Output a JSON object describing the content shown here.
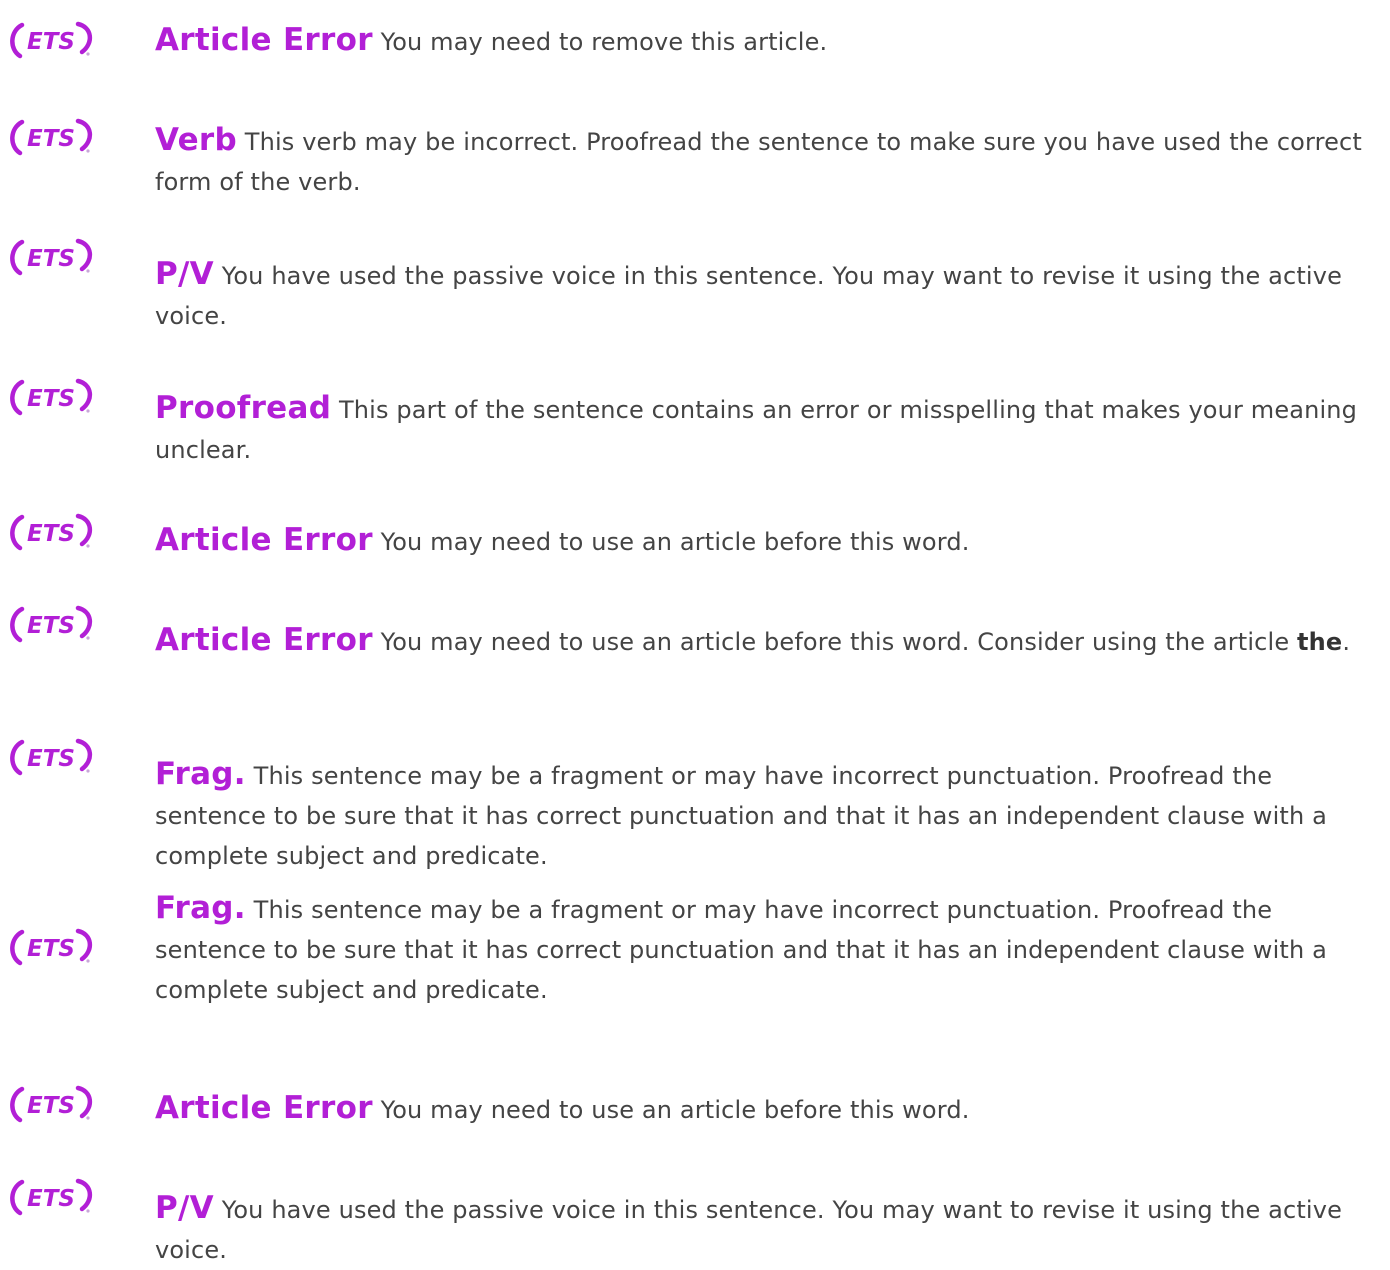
{
  "brand": {
    "logo_text": "ETS",
    "accent_color": "#b21fd6",
    "text_color": "#444444"
  },
  "comments": [
    {
      "label": "Article Error",
      "message": "You may need to remove this article."
    },
    {
      "label": "Verb",
      "message": "This verb may be incorrect. Proofread the sentence to make sure you have used the correct form of the verb."
    },
    {
      "label": "P/V",
      "message": "You have used the passive voice in this sentence. You may want to revise it using the active voice."
    },
    {
      "label": "Proofread",
      "message": "This part of the sentence contains an error or misspelling that makes your meaning unclear."
    },
    {
      "label": "Article Error",
      "message": "You may need to use an article before this word."
    },
    {
      "label": "Article Error",
      "message": "You may need to use an article before this word. Consider using the article",
      "emphasis": "the",
      "suffix": "."
    },
    {
      "label": "Frag.",
      "message": "This sentence may be a fragment or may have incorrect punctuation. Proofread the sentence to be sure that it has correct punctuation and that it has an independent clause with a complete subject and predicate."
    },
    {
      "label": "Frag.",
      "message": "This sentence may be a fragment or may have incorrect punctuation. Proofread the sentence to be sure that it has correct punctuation and that it has an independent clause with a complete subject and predicate."
    },
    {
      "label": "Article Error",
      "message": "You may need to use an article before this word."
    },
    {
      "label": "P/V",
      "message": "You have used the passive voice in this sentence. You may want to revise it using the active voice."
    }
  ]
}
